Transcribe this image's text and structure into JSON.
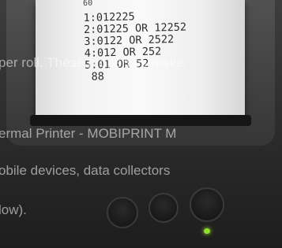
{
  "receipt": {
    "header": "60",
    "lines": [
      "1:012225",
      "2:01225 OR 12252",
      "3:0122 OR 2522",
      "4:012 OR 252",
      "5:01 OR 52",
      " 88"
    ]
  },
  "overlay_text": {
    "line1": "per roll. These properties make",
    "line2": "ermal Printer - MOBIPRINT M",
    "line3": "obile devices, data collectors",
    "line4": "low)."
  },
  "colors": {
    "led": "#8fe02a",
    "paper": "#f5f5f5",
    "printer": "#2b2b2b"
  }
}
